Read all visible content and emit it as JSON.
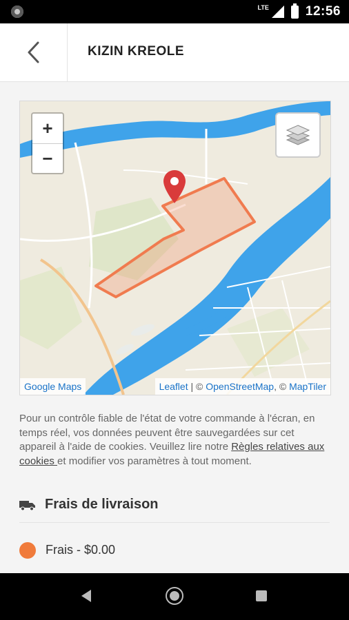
{
  "status_bar": {
    "network": "LTE",
    "time": "12:56"
  },
  "header": {
    "title": "KIZIN KREOLE",
    "back_icon": "chevron-left-icon"
  },
  "map": {
    "zoom_in_label": "+",
    "zoom_out_label": "−",
    "layers_icon": "layers-icon",
    "marker_icon": "map-pin-icon",
    "attribution_left": "Google Maps",
    "attribution_leaflet": "Leaflet",
    "attribution_sep1": " | © ",
    "attribution_osm": "OpenStreetMap",
    "attribution_sep2": ", © ",
    "attribution_maptiler": "MapTiler",
    "zone_color": "#f07b4f",
    "water_color": "#3fa3ea",
    "land_color": "#efebdf"
  },
  "cookie_notice": {
    "text_before": "Pour un contrôle fiable de l'état de votre commande à l'écran, en temps réel, vos données peuvent être sauvegardées sur cet appareil à l'aide de cookies. Veuillez lire notre ",
    "link_text": "Règles relatives aux cookies ",
    "text_after": "et modifier vos paramètres à tout moment."
  },
  "delivery": {
    "section_title": "Frais de livraison",
    "section_icon": "truck-icon",
    "fee_label": "Frais - $0.00",
    "fee_color": "#f07b3b"
  }
}
